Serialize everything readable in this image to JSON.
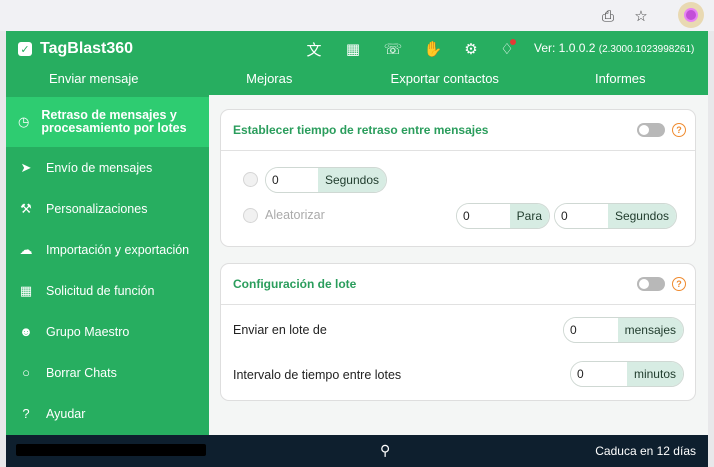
{
  "app": {
    "name": "TagBlast360",
    "version_label": "Ver: 1.0.0.2",
    "version_build": "(2.3000.1023998261)"
  },
  "nav": [
    "Enviar mensaje",
    "Mejoras",
    "Exportar contactos",
    "Informes"
  ],
  "sidebar": {
    "items": [
      {
        "label": "Retraso de mensajes y procesamiento por lotes",
        "icon": "clock-settings-icon",
        "active": true
      },
      {
        "label": "Envío de mensajes",
        "icon": "send-icon"
      },
      {
        "label": "Personalizaciones",
        "icon": "wrench-icon"
      },
      {
        "label": "Importación y exportación",
        "icon": "cloud-upload-icon"
      },
      {
        "label": "Solicitud de función",
        "icon": "grid-icon"
      },
      {
        "label": "Grupo Maestro",
        "icon": "users-icon"
      },
      {
        "label": "Borrar Chats",
        "icon": "chat-icon"
      },
      {
        "label": "Ayudar",
        "icon": "help-icon"
      }
    ]
  },
  "delay_card": {
    "title": "Establecer tiempo de retraso entre mensajes",
    "fixed_value": "0",
    "fixed_unit": "Segundos",
    "random_label": "Aleatorizar",
    "random_from": "0",
    "random_mid": "Para",
    "random_to": "0",
    "random_unit": "Segundos"
  },
  "batch_card": {
    "title": "Configuración de lote",
    "send_label": "Enviar en lote de",
    "send_value": "0",
    "send_unit": "mensajes",
    "interval_label": "Intervalo de tiempo entre lotes",
    "interval_value": "0",
    "interval_unit": "minutos"
  },
  "footer": {
    "expiry": "Caduca en 12 días"
  },
  "colors": {
    "primary": "#27ae60",
    "active": "#2ecc71",
    "footer": "#0e1f2e",
    "accent_help": "#ef8a2e"
  }
}
